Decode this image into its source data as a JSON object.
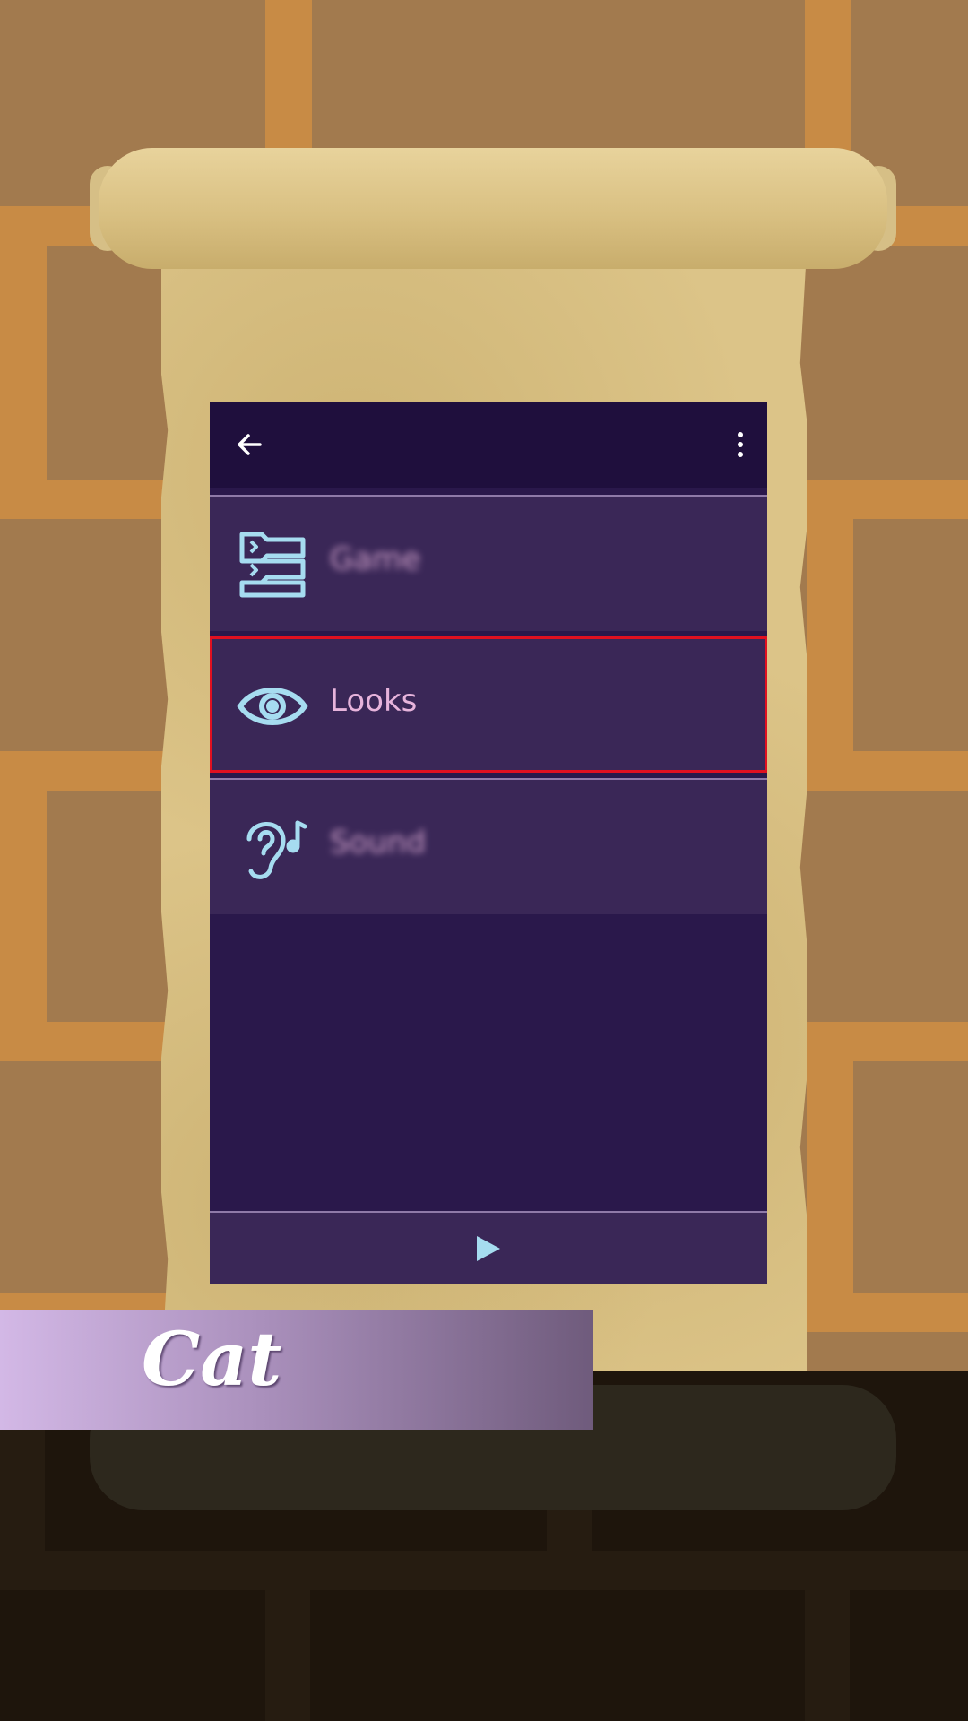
{
  "app_bar": {
    "back_icon": "arrow-back-icon",
    "more_icon": "more-vertical-icon"
  },
  "categories": [
    {
      "label": "Game",
      "icon": "script-blocks-icon",
      "blurred": true
    },
    {
      "label": "Looks",
      "icon": "eye-icon",
      "blurred": false,
      "highlighted": true
    },
    {
      "label": "Sound",
      "icon": "ear-music-icon",
      "blurred": true
    }
  ],
  "bottom_bar": {
    "play_icon": "play-icon"
  },
  "banner": {
    "title": "Cat"
  },
  "colors": {
    "icon": "#a6dcf0",
    "label": "#e7b4dc",
    "highlight": "#e01020",
    "app_background": "#2a184b",
    "category_background": "#3a2757"
  }
}
